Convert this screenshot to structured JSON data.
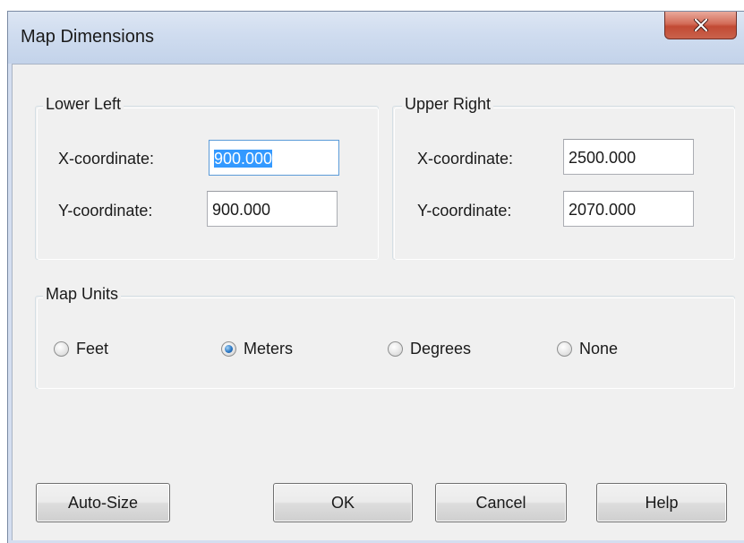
{
  "window": {
    "title": "Map Dimensions",
    "close_icon": "close-x-icon",
    "close_color": "#c9463a"
  },
  "lower_left": {
    "group_label": "Lower Left",
    "x_label": "X-coordinate:",
    "x_value": "900.000",
    "y_label": "Y-coordinate:",
    "y_value": "900.000"
  },
  "upper_right": {
    "group_label": "Upper Right",
    "x_label": "X-coordinate:",
    "x_value": "2500.000",
    "y_label": "Y-coordinate:",
    "y_value": "2070.000"
  },
  "map_units": {
    "group_label": "Map Units",
    "selected": "Meters",
    "options": [
      {
        "label": "Feet",
        "checked": false
      },
      {
        "label": "Meters",
        "checked": true
      },
      {
        "label": "Degrees",
        "checked": false
      },
      {
        "label": "None",
        "checked": false
      }
    ]
  },
  "buttons": {
    "auto_size": "Auto-Size",
    "ok": "OK",
    "cancel": "Cancel",
    "help": "Help"
  },
  "colors": {
    "selection": "#3399ff",
    "radio_selected": "#2c78c4"
  }
}
